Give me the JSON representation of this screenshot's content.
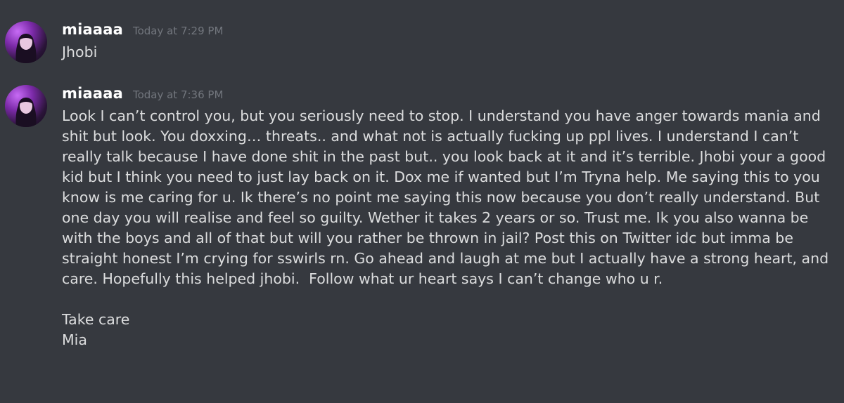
{
  "messages": [
    {
      "username": "miaaaa",
      "timestamp": "Today at 7:29 PM",
      "text": "Jhobi"
    },
    {
      "username": "miaaaa",
      "timestamp": "Today at 7:36 PM",
      "text": "Look I can’t control you, but you seriously need to stop. I understand you have anger towards mania and shit but look. You doxxing… threats.. and what not is actually fucking up ppl lives. I understand I can’t really talk because I have done shit in the past but.. you look back at it and it’s terrible. Jhobi your a good kid but I think you need to just lay back on it. Dox me if wanted but I’m Tryna help. Me saying this to you know is me caring for u. Ik there’s no point me saying this now because you don’t really understand. But one day you will realise and feel so guilty. Wether it takes 2 years or so. Trust me. Ik you also wanna be with the boys and all of that but will you rather be thrown in jail? Post this on Twitter idc but imma be straight honest I’m crying for sswirls rn. Go ahead and laugh at me but I actually have a strong heart, and care. Hopefully this helped jhobi.  Follow what ur heart says I can’t change who u r.\n\nTake care\nMia"
    }
  ]
}
